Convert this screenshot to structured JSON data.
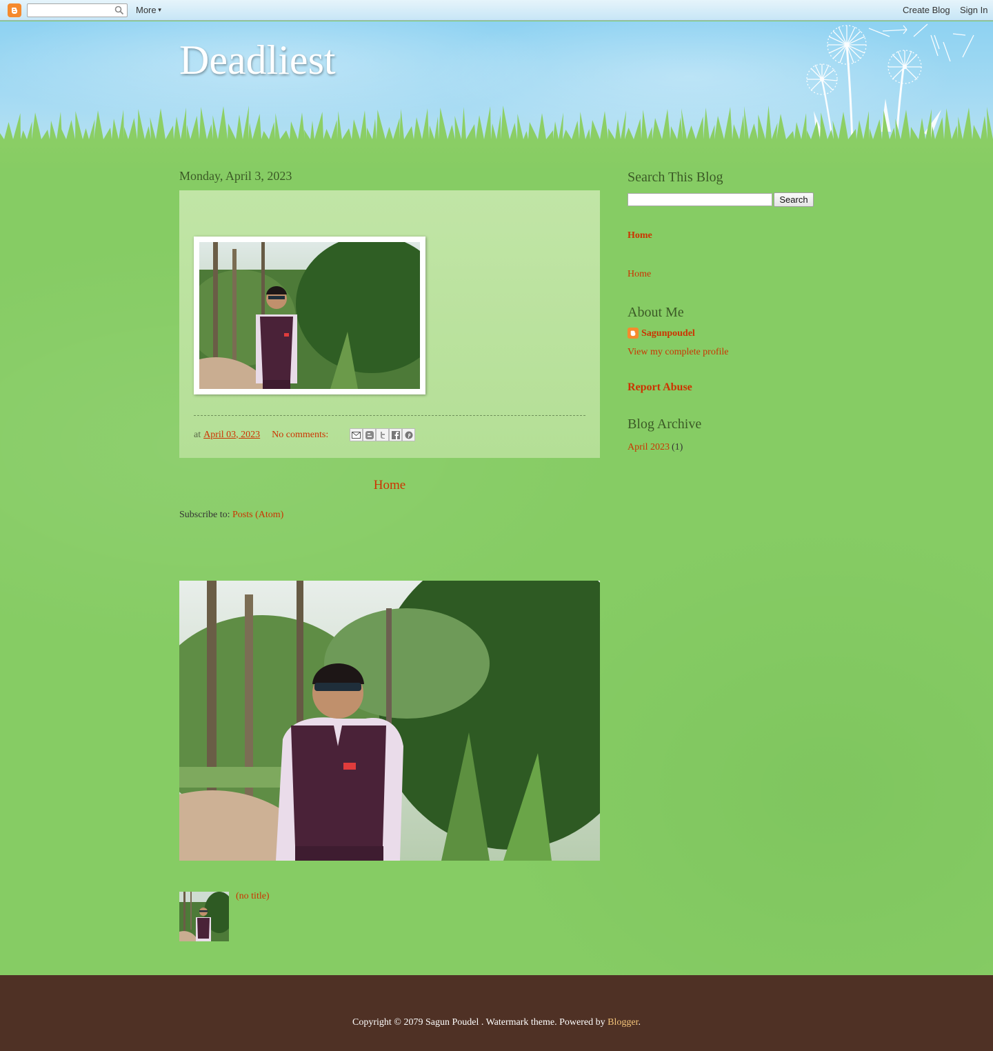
{
  "navbar": {
    "more_label": "More",
    "create_blog_label": "Create Blog",
    "sign_in_label": "Sign In"
  },
  "header": {
    "blog_title": "Deadliest"
  },
  "post": {
    "date_header": "Monday, April 3, 2023",
    "at_label": "at",
    "timestamp": "April 03, 2023",
    "comments_label": "No comments:",
    "share_icons": [
      "email-icon",
      "blogthis-icon",
      "twitter-icon",
      "facebook-icon",
      "pinterest-icon"
    ]
  },
  "pager": {
    "home_label": "Home"
  },
  "feed": {
    "subscribe_label": "Subscribe to:",
    "posts_link": "Posts (Atom)"
  },
  "popular": {
    "item_title": "(no title)"
  },
  "sidebar": {
    "search_heading": "Search This Blog",
    "search_button": "Search",
    "pages_title": "Home",
    "pages_item": "Home",
    "about_heading": "About Me",
    "profile_name": "Sagunpoudel",
    "profile_link": "View my complete profile",
    "report_abuse": "Report Abuse",
    "archive_heading": "Blog Archive",
    "archive_month": "April 2023",
    "archive_count": "(1)"
  },
  "footer": {
    "copyright_text": "Copyright © 2079 Sagun Poudel . Watermark theme. Powered by ",
    "blogger_link": "Blogger",
    "period": "."
  },
  "colors": {
    "link": "#cc3300",
    "grass": "#86cc64",
    "footer_bg": "#4f3125",
    "sky": "#8ed2f2"
  }
}
